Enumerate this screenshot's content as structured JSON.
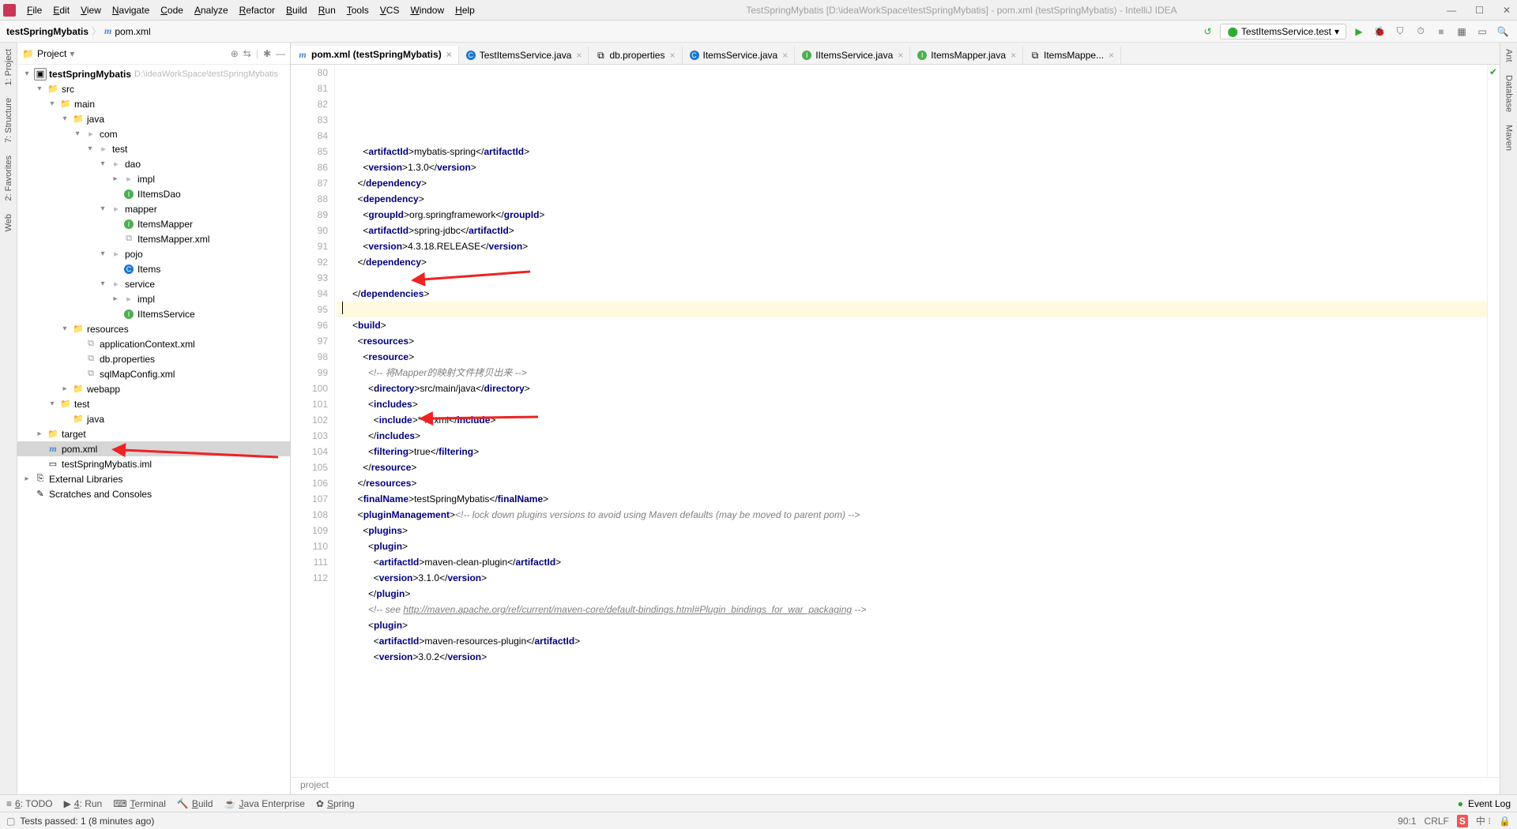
{
  "window": {
    "title": "TestSpringMybatis [D:\\ideaWorkSpace\\testSpringMybatis] - pom.xml (testSpringMybatis) - IntelliJ IDEA"
  },
  "menubar": [
    "File",
    "Edit",
    "View",
    "Navigate",
    "Code",
    "Analyze",
    "Refactor",
    "Build",
    "Run",
    "Tools",
    "VCS",
    "Window",
    "Help"
  ],
  "breadcrumb": {
    "project": "testSpringMybatis",
    "file": "pom.xml"
  },
  "run_config": {
    "label": "TestItemsService.test"
  },
  "sidebar": {
    "header": "Project",
    "tree": [
      {
        "d": 0,
        "tw": "▾",
        "ic": "module",
        "label": "testSpringMybatis",
        "hint": "D:\\ideaWorkSpace\\testSpringMybatis"
      },
      {
        "d": 1,
        "tw": "▾",
        "ic": "folder-blue",
        "label": "src"
      },
      {
        "d": 2,
        "tw": "▾",
        "ic": "folder",
        "label": "main"
      },
      {
        "d": 3,
        "tw": "▾",
        "ic": "folder-blue",
        "label": "java"
      },
      {
        "d": 4,
        "tw": "▾",
        "ic": "pkg",
        "label": "com"
      },
      {
        "d": 5,
        "tw": "▾",
        "ic": "pkg",
        "label": "test"
      },
      {
        "d": 6,
        "tw": "▾",
        "ic": "pkg",
        "label": "dao"
      },
      {
        "d": 7,
        "tw": "▸",
        "ic": "pkg",
        "label": "impl"
      },
      {
        "d": 7,
        "tw": "",
        "ic": "iface",
        "label": "IItemsDao"
      },
      {
        "d": 6,
        "tw": "▾",
        "ic": "pkg",
        "label": "mapper"
      },
      {
        "d": 7,
        "tw": "",
        "ic": "iface",
        "label": "ItemsMapper"
      },
      {
        "d": 7,
        "tw": "",
        "ic": "xml",
        "label": "ItemsMapper.xml"
      },
      {
        "d": 6,
        "tw": "▾",
        "ic": "pkg",
        "label": "pojo"
      },
      {
        "d": 7,
        "tw": "",
        "ic": "class",
        "label": "Items"
      },
      {
        "d": 6,
        "tw": "▾",
        "ic": "pkg",
        "label": "service"
      },
      {
        "d": 7,
        "tw": "▸",
        "ic": "pkg",
        "label": "impl"
      },
      {
        "d": 7,
        "tw": "",
        "ic": "iface",
        "label": "IItemsService"
      },
      {
        "d": 3,
        "tw": "▾",
        "ic": "folder-yellow",
        "label": "resources"
      },
      {
        "d": 4,
        "tw": "",
        "ic": "xml",
        "label": "applicationContext.xml"
      },
      {
        "d": 4,
        "tw": "",
        "ic": "xml",
        "label": "db.properties"
      },
      {
        "d": 4,
        "tw": "",
        "ic": "xml",
        "label": "sqlMapConfig.xml"
      },
      {
        "d": 3,
        "tw": "▸",
        "ic": "folder-blue",
        "label": "webapp"
      },
      {
        "d": 2,
        "tw": "▾",
        "ic": "folder",
        "label": "test"
      },
      {
        "d": 3,
        "tw": "",
        "ic": "folder-green",
        "label": "java"
      },
      {
        "d": 1,
        "tw": "▸",
        "ic": "folder-orange",
        "label": "target"
      },
      {
        "d": 1,
        "tw": "",
        "ic": "m",
        "label": "pom.xml",
        "sel": true
      },
      {
        "d": 1,
        "tw": "",
        "ic": "file",
        "label": "testSpringMybatis.iml"
      },
      {
        "d": 0,
        "tw": "▸",
        "ic": "lib",
        "label": "External Libraries"
      },
      {
        "d": 0,
        "tw": "",
        "ic": "scratch",
        "label": "Scratches and Consoles"
      }
    ]
  },
  "leftrail": [
    "1: Project",
    "7: Structure",
    "2: Favorites",
    "Web"
  ],
  "rightrail": [
    "Ant",
    "Database",
    "Maven"
  ],
  "tabs": [
    {
      "icon": "m",
      "label": "pom.xml (testSpringMybatis)",
      "active": true
    },
    {
      "icon": "class",
      "label": "TestItemsService.java"
    },
    {
      "icon": "xml",
      "label": "db.properties"
    },
    {
      "icon": "class",
      "label": "ItemsService.java"
    },
    {
      "icon": "iface",
      "label": "IItemsService.java"
    },
    {
      "icon": "iface",
      "label": "ItemsMapper.java"
    },
    {
      "icon": "xml",
      "label": "ItemsMappe..."
    }
  ],
  "code": {
    "start": 80,
    "highlight": 90,
    "lines": [
      {
        "n": 80,
        "ind": 4,
        "seg": [
          [
            "brk",
            "<"
          ],
          [
            "tag",
            "artifactId"
          ],
          [
            "brk",
            ">"
          ],
          [
            "txt",
            "mybatis-spring"
          ],
          [
            "brk",
            "</"
          ],
          [
            "tag",
            "artifactId"
          ],
          [
            "brk",
            ">"
          ]
        ]
      },
      {
        "n": 81,
        "ind": 4,
        "seg": [
          [
            "brk",
            "<"
          ],
          [
            "tag",
            "version"
          ],
          [
            "brk",
            ">"
          ],
          [
            "txt",
            "1.3.0"
          ],
          [
            "brk",
            "</"
          ],
          [
            "tag",
            "version"
          ],
          [
            "brk",
            ">"
          ]
        ]
      },
      {
        "n": 82,
        "ind": 3,
        "seg": [
          [
            "brk",
            "</"
          ],
          [
            "tag",
            "dependency"
          ],
          [
            "brk",
            ">"
          ]
        ]
      },
      {
        "n": 83,
        "ind": 3,
        "seg": [
          [
            "brk",
            "<"
          ],
          [
            "tag",
            "dependency"
          ],
          [
            "brk",
            ">"
          ]
        ]
      },
      {
        "n": 84,
        "ind": 4,
        "seg": [
          [
            "brk",
            "<"
          ],
          [
            "tag",
            "groupId"
          ],
          [
            "brk",
            ">"
          ],
          [
            "txt",
            "org.springframework"
          ],
          [
            "brk",
            "</"
          ],
          [
            "tag",
            "groupId"
          ],
          [
            "brk",
            ">"
          ]
        ]
      },
      {
        "n": 85,
        "ind": 4,
        "seg": [
          [
            "brk",
            "<"
          ],
          [
            "tag",
            "artifactId"
          ],
          [
            "brk",
            ">"
          ],
          [
            "txt",
            "spring-jdbc"
          ],
          [
            "brk",
            "</"
          ],
          [
            "tag",
            "artifactId"
          ],
          [
            "brk",
            ">"
          ]
        ]
      },
      {
        "n": 86,
        "ind": 4,
        "seg": [
          [
            "brk",
            "<"
          ],
          [
            "tag",
            "version"
          ],
          [
            "brk",
            ">"
          ],
          [
            "txt",
            "4.3.18.RELEASE"
          ],
          [
            "brk",
            "</"
          ],
          [
            "tag",
            "version"
          ],
          [
            "brk",
            ">"
          ]
        ]
      },
      {
        "n": 87,
        "ind": 3,
        "seg": [
          [
            "brk",
            "</"
          ],
          [
            "tag",
            "dependency"
          ],
          [
            "brk",
            ">"
          ]
        ]
      },
      {
        "n": 88,
        "ind": 0,
        "seg": []
      },
      {
        "n": 89,
        "ind": 2,
        "seg": [
          [
            "brk",
            "</"
          ],
          [
            "tag",
            "dependencies"
          ],
          [
            "brk",
            ">"
          ]
        ]
      },
      {
        "n": 90,
        "ind": 0,
        "seg": []
      },
      {
        "n": 91,
        "ind": 2,
        "seg": [
          [
            "brk",
            "<"
          ],
          [
            "tag",
            "build"
          ],
          [
            "brk",
            ">"
          ]
        ]
      },
      {
        "n": 92,
        "ind": 3,
        "seg": [
          [
            "brk",
            "<"
          ],
          [
            "tag",
            "resources"
          ],
          [
            "brk",
            ">"
          ]
        ]
      },
      {
        "n": 93,
        "ind": 4,
        "seg": [
          [
            "brk",
            "<"
          ],
          [
            "tag",
            "resource"
          ],
          [
            "brk",
            ">"
          ]
        ]
      },
      {
        "n": 94,
        "ind": 5,
        "seg": [
          [
            "cmt",
            "<!-- 将Mapper的映射文件拷贝出来 -->"
          ]
        ]
      },
      {
        "n": 95,
        "ind": 5,
        "seg": [
          [
            "brk",
            "<"
          ],
          [
            "tag",
            "directory"
          ],
          [
            "brk",
            ">"
          ],
          [
            "txt",
            "src/main/java"
          ],
          [
            "brk",
            "</"
          ],
          [
            "tag",
            "directory"
          ],
          [
            "brk",
            ">"
          ]
        ]
      },
      {
        "n": 96,
        "ind": 5,
        "seg": [
          [
            "brk",
            "<"
          ],
          [
            "tag",
            "includes"
          ],
          [
            "brk",
            ">"
          ]
        ]
      },
      {
        "n": 97,
        "ind": 6,
        "seg": [
          [
            "brk",
            "<"
          ],
          [
            "tag",
            "include"
          ],
          [
            "brk",
            ">"
          ],
          [
            "txt",
            "**/*.xml"
          ],
          [
            "brk",
            "</"
          ],
          [
            "tag",
            "include"
          ],
          [
            "brk",
            ">"
          ]
        ]
      },
      {
        "n": 98,
        "ind": 5,
        "seg": [
          [
            "brk",
            "</"
          ],
          [
            "tag",
            "includes"
          ],
          [
            "brk",
            ">"
          ]
        ]
      },
      {
        "n": 99,
        "ind": 5,
        "seg": [
          [
            "brk",
            "<"
          ],
          [
            "tag",
            "filtering"
          ],
          [
            "brk",
            ">"
          ],
          [
            "txt",
            "true"
          ],
          [
            "brk",
            "</"
          ],
          [
            "tag",
            "filtering"
          ],
          [
            "brk",
            ">"
          ]
        ]
      },
      {
        "n": 100,
        "ind": 4,
        "seg": [
          [
            "brk",
            "</"
          ],
          [
            "tag",
            "resource"
          ],
          [
            "brk",
            ">"
          ]
        ]
      },
      {
        "n": 101,
        "ind": 3,
        "seg": [
          [
            "brk",
            "</"
          ],
          [
            "tag",
            "resources"
          ],
          [
            "brk",
            ">"
          ]
        ]
      },
      {
        "n": 102,
        "ind": 3,
        "seg": [
          [
            "brk",
            "<"
          ],
          [
            "tag",
            "finalName"
          ],
          [
            "brk",
            ">"
          ],
          [
            "txt",
            "testSpringMybatis"
          ],
          [
            "brk",
            "</"
          ],
          [
            "tag",
            "finalName"
          ],
          [
            "brk",
            ">"
          ]
        ]
      },
      {
        "n": 103,
        "ind": 3,
        "seg": [
          [
            "brk",
            "<"
          ],
          [
            "tag",
            "pluginManagement"
          ],
          [
            "brk",
            ">"
          ],
          [
            "cmt",
            "<!-- lock down plugins versions to avoid using Maven defaults (may be moved to parent pom) -->"
          ]
        ]
      },
      {
        "n": 104,
        "ind": 4,
        "seg": [
          [
            "brk",
            "<"
          ],
          [
            "tag",
            "plugins"
          ],
          [
            "brk",
            ">"
          ]
        ]
      },
      {
        "n": 105,
        "ind": 5,
        "seg": [
          [
            "brk",
            "<"
          ],
          [
            "tag",
            "plugin"
          ],
          [
            "brk",
            ">"
          ]
        ]
      },
      {
        "n": 106,
        "ind": 6,
        "seg": [
          [
            "brk",
            "<"
          ],
          [
            "tag",
            "artifactId"
          ],
          [
            "brk",
            ">"
          ],
          [
            "txt",
            "maven-clean-plugin"
          ],
          [
            "brk",
            "</"
          ],
          [
            "tag",
            "artifactId"
          ],
          [
            "brk",
            ">"
          ]
        ]
      },
      {
        "n": 107,
        "ind": 6,
        "seg": [
          [
            "brk",
            "<"
          ],
          [
            "tag",
            "version"
          ],
          [
            "brk",
            ">"
          ],
          [
            "txt",
            "3.1.0"
          ],
          [
            "brk",
            "</"
          ],
          [
            "tag",
            "version"
          ],
          [
            "brk",
            ">"
          ]
        ]
      },
      {
        "n": 108,
        "ind": 5,
        "seg": [
          [
            "brk",
            "</"
          ],
          [
            "tag",
            "plugin"
          ],
          [
            "brk",
            ">"
          ]
        ]
      },
      {
        "n": 109,
        "ind": 5,
        "seg": [
          [
            "cmt",
            "<!-- see "
          ],
          [
            "link",
            "http://maven.apache.org/ref/current/maven-core/default-bindings.html#Plugin_bindings_for_war_packaging"
          ],
          [
            "cmt",
            " -->"
          ]
        ]
      },
      {
        "n": 110,
        "ind": 5,
        "seg": [
          [
            "brk",
            "<"
          ],
          [
            "tag",
            "plugin"
          ],
          [
            "brk",
            ">"
          ]
        ]
      },
      {
        "n": 111,
        "ind": 6,
        "seg": [
          [
            "brk",
            "<"
          ],
          [
            "tag",
            "artifactId"
          ],
          [
            "brk",
            ">"
          ],
          [
            "txt",
            "maven-resources-plugin"
          ],
          [
            "brk",
            "</"
          ],
          [
            "tag",
            "artifactId"
          ],
          [
            "brk",
            ">"
          ]
        ]
      },
      {
        "n": 112,
        "ind": 6,
        "seg": [
          [
            "brk",
            "<"
          ],
          [
            "tag",
            "version"
          ],
          [
            "brk",
            ">"
          ],
          [
            "txt",
            "3.0.2"
          ],
          [
            "brk",
            "</"
          ],
          [
            "tag",
            "version"
          ],
          [
            "brk",
            ">"
          ]
        ]
      }
    ]
  },
  "editor_breadcrumb": "project",
  "toolwindows": [
    "6: TODO",
    "4: Run",
    "Terminal",
    "Build",
    "Java Enterprise",
    "Spring"
  ],
  "eventlog": "Event Log",
  "status": {
    "msg": "Tests passed: 1 (8 minutes ago)",
    "pos": "90:1",
    "eol": "CRLF"
  }
}
